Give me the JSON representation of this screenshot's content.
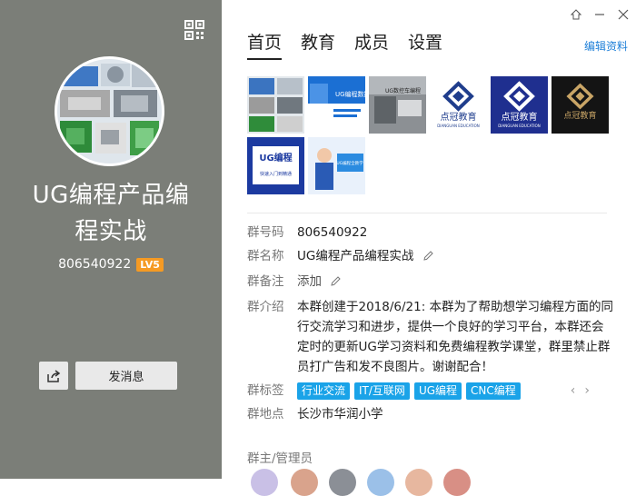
{
  "group": {
    "name": "UG编程产品编程实战",
    "name_line1": "UG编程产品编",
    "name_line2": "程实战",
    "id": "806540922",
    "level": "LV5"
  },
  "left_actions": {
    "send_message": "发消息"
  },
  "tabs": [
    {
      "label": "首页",
      "active": true
    },
    {
      "label": "教育",
      "active": false
    },
    {
      "label": "成员",
      "active": false
    },
    {
      "label": "设置",
      "active": false
    }
  ],
  "edit_profile": "编辑资料",
  "album": [
    {
      "name": "parts-collage",
      "caption": ""
    },
    {
      "name": "ug-nc-ad",
      "caption": "UG编程数控"
    },
    {
      "name": "lathe-photo",
      "caption": "UG数控车编程"
    },
    {
      "name": "dianguan-logo-white",
      "caption": "点冠教育",
      "sub": "DIANGUAN EDUCATION"
    },
    {
      "name": "dianguan-logo-blue",
      "caption": "点冠教育",
      "sub": "DIANGUAN EDUCATION"
    },
    {
      "name": "dianguan-logo-black",
      "caption": "点冠教育"
    },
    {
      "name": "ug-course-card",
      "caption": "UG编程",
      "sub": "快速入门到精通"
    },
    {
      "name": "teacher-photo",
      "caption": "UG编程全教学"
    }
  ],
  "info": {
    "id_label": "群号码",
    "id_value": "806540922",
    "name_label": "群名称",
    "name_value": "UG编程产品编程实战",
    "remark_label": "群备注",
    "remark_value": "添加",
    "intro_label": "群介绍",
    "intro_value": "本群创建于2018/6/21:    本群为了帮助想学习编程方面的同行交流学习和进步，提供一个良好的学习平台，本群还会定时的更新UG学习资料和免费编程教学课堂，群里禁止群员打广告和发不良图片。谢谢配合！",
    "tags_label": "群标签",
    "tags": [
      "行业交流",
      "IT/互联网",
      "UG编程",
      "CNC编程"
    ],
    "location_label": "群地点",
    "location_value": "长沙市华润小学",
    "admins_label": "群主/管理员"
  },
  "colors": {
    "left_bg": "#7b7e78",
    "level_badge": "#f59a23",
    "tag_bg": "#1aa3e8",
    "link": "#1e7fd8"
  }
}
